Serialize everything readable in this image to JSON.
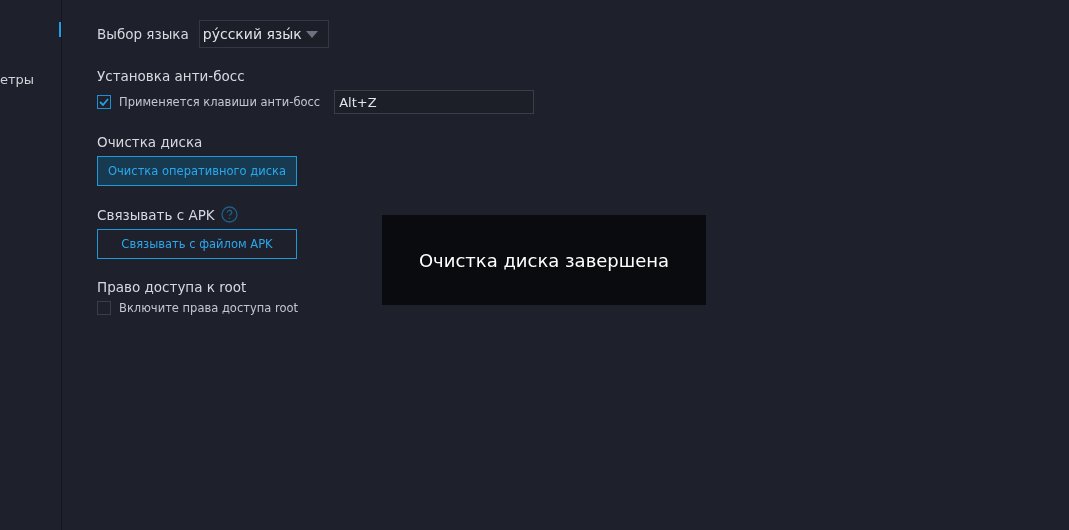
{
  "sidebar": {
    "items": [
      {
        "label": "етры"
      }
    ]
  },
  "settings": [
    {
      "kind": "select",
      "title": "Выбор языка",
      "value": "ру́сский язы́к"
    },
    {
      "kind": "hotkey",
      "title": "Установка анти-босс",
      "checkbox": {
        "label": "Применяется клавиши анти-босс",
        "checked": true
      },
      "value": "Alt+Z"
    },
    {
      "kind": "button",
      "title": "Очистка диска",
      "button": {
        "label": "Очистка оперативного диска",
        "filled": true
      }
    },
    {
      "kind": "button",
      "title": "Связывать с APK",
      "help": true,
      "button": {
        "label": "Связывать с файлом APK",
        "filled": false
      }
    },
    {
      "kind": "checkbox",
      "title": "Право доступа к root",
      "checkbox": {
        "label": "Включите права доступа root",
        "checked": false
      }
    }
  ],
  "toast": {
    "message": "Очистка диска завершена"
  }
}
